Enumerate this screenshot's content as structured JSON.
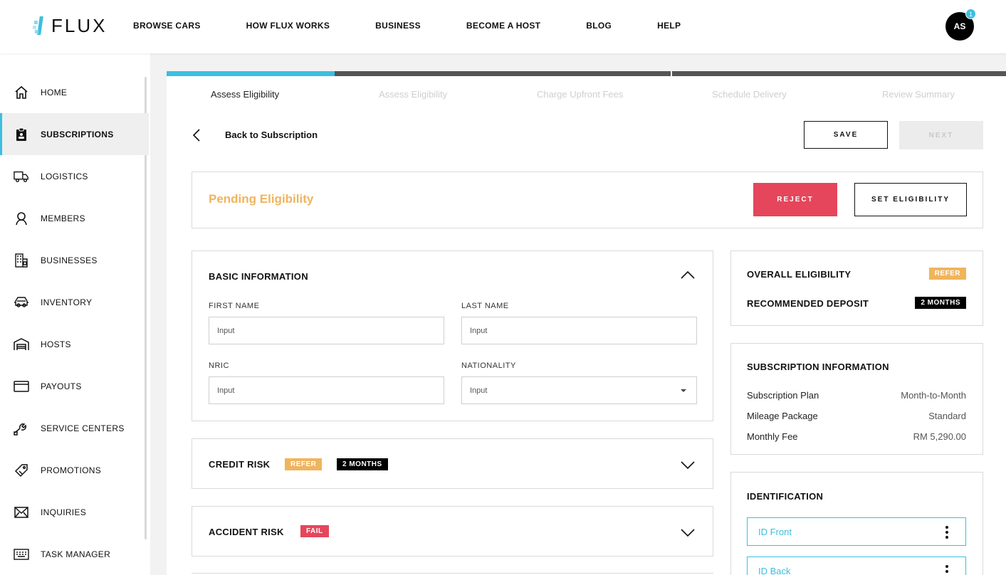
{
  "brand": {
    "name": "FLUX",
    "accent": "#3bbfe0"
  },
  "topnav": {
    "links": [
      "BROWSE CARS",
      "HOW FLUX WORKS",
      "BUSINESS",
      "BECOME A HOST",
      "BLOG",
      "HELP"
    ],
    "avatar_initials": "AS",
    "notification_count": "1"
  },
  "sidebar": {
    "items": [
      {
        "label": "HOME",
        "icon": "home-icon"
      },
      {
        "label": "SUBSCRIPTIONS",
        "icon": "clipboard-icon",
        "active": true
      },
      {
        "label": "LOGISTICS",
        "icon": "truck-icon"
      },
      {
        "label": "MEMBERS",
        "icon": "user-icon"
      },
      {
        "label": "BUSINESSES",
        "icon": "building-icon"
      },
      {
        "label": "INVENTORY",
        "icon": "cars-icon"
      },
      {
        "label": "HOSTS",
        "icon": "garage-icon"
      },
      {
        "label": "PAYOUTS",
        "icon": "card-icon"
      },
      {
        "label": "SERVICE CENTERS",
        "icon": "wrench-icon"
      },
      {
        "label": "PROMOTIONS",
        "icon": "tag-icon"
      },
      {
        "label": "INQUIRIES",
        "icon": "envelope-icon"
      },
      {
        "label": "TASK MANAGER",
        "icon": "keyboard-icon"
      }
    ]
  },
  "stepper": {
    "steps": [
      "Assess Eligibility",
      "Assess Eligibility",
      "Charge Upfront Fees",
      "Schedule Delivery",
      "Review Summary"
    ],
    "active_index": 0
  },
  "header": {
    "back_label": "Back to Subscription",
    "save_label": "SAVE",
    "next_label": "NEXT"
  },
  "status": {
    "title": "Pending Eligibility",
    "reject_label": "REJECT",
    "set_eligibility_label": "SET ELIGIBILITY",
    "color": "#f0b45c"
  },
  "basic_info": {
    "title": "BASIC INFORMATION",
    "first_name": {
      "label": "FIRST NAME",
      "value": "Input"
    },
    "last_name": {
      "label": "LAST NAME",
      "value": "Input"
    },
    "nric": {
      "label": "NRIC",
      "value": "Input"
    },
    "nationality": {
      "label": "NATIONALITY",
      "value": "Input"
    }
  },
  "credit_risk": {
    "title": "CREDIT RISK",
    "badge1": "REFER",
    "badge2": "2 MONTHS"
  },
  "accident_risk": {
    "title": "ACCIDENT RISK",
    "badge": "FAIL"
  },
  "eligibility": {
    "overall_label": "OVERALL ELIGIBILITY",
    "overall_badge": "REFER",
    "deposit_label": "RECOMMENDED DEPOSIT",
    "deposit_badge": "2 MONTHS"
  },
  "subscription_info": {
    "title": "SUBSCRIPTION INFORMATION",
    "rows": [
      {
        "label": "Subscription Plan",
        "value": "Month-to-Month"
      },
      {
        "label": "Mileage Package",
        "value": "Standard"
      },
      {
        "label": "Monthly Fee",
        "value": "RM 5,290.00"
      }
    ]
  },
  "identification": {
    "title": "IDENTIFICATION",
    "items": [
      "ID Front",
      "ID Back"
    ]
  }
}
